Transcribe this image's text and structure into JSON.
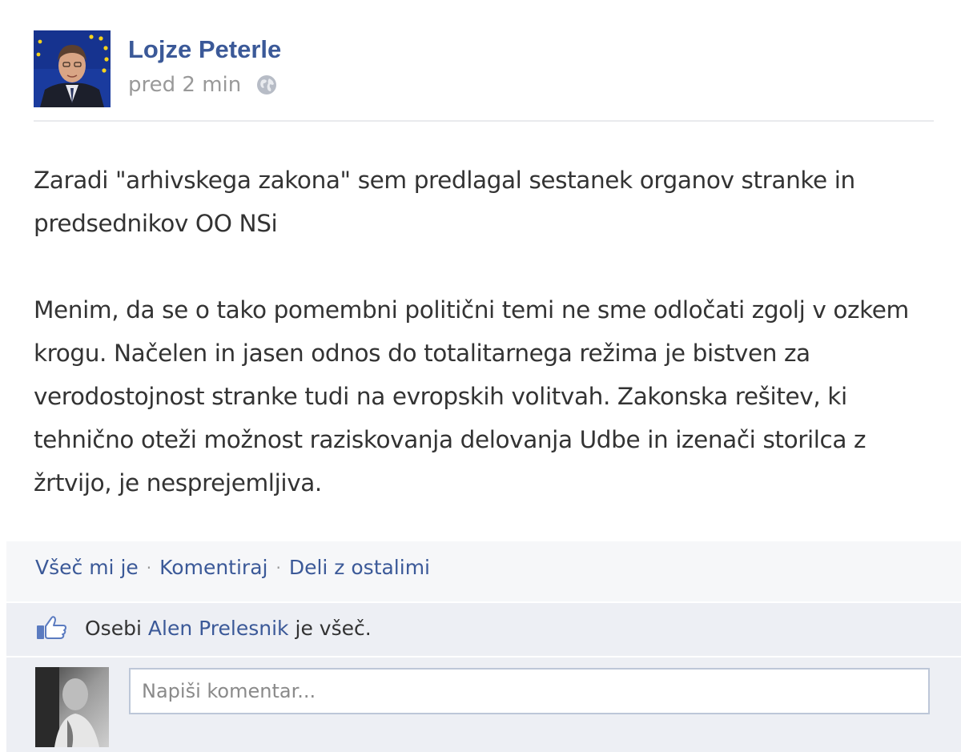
{
  "post": {
    "author": "Lojze Peterle",
    "time": "pred 2 min",
    "privacy_icon": "globe-icon",
    "paragraphs": [
      "Zaradi \"arhivskega zakona\" sem predlagal sestanek organov stranke in predsednikov OO NSi",
      "Menim, da se o tako pomembni politični temi ne sme odločati zgolj v ozkem krogu. Načelen in jasen odnos do totalitarnega režima je bistven za verodostojnost stranke tudi na evropskih volitvah. Zakonska rešitev, ki tehnično oteži možnost raziskovanja delovanja Udbe in izenači storilca z žrtvijo, je nesprejemljiva."
    ]
  },
  "actions": {
    "like": "Všeč mi je",
    "comment": "Komentiraj",
    "share": "Deli z ostalimi",
    "separator": "·"
  },
  "likes": {
    "icon": "thumbs-up-icon",
    "prefix": "Osebi",
    "person": "Alen Prelesnik",
    "suffix": "je všeč."
  },
  "comment": {
    "placeholder": "Napiši komentar..."
  },
  "colors": {
    "link": "#3b5998",
    "muted": "#999999",
    "bar_background": "#edeff4",
    "actions_background": "#f6f7f9"
  }
}
